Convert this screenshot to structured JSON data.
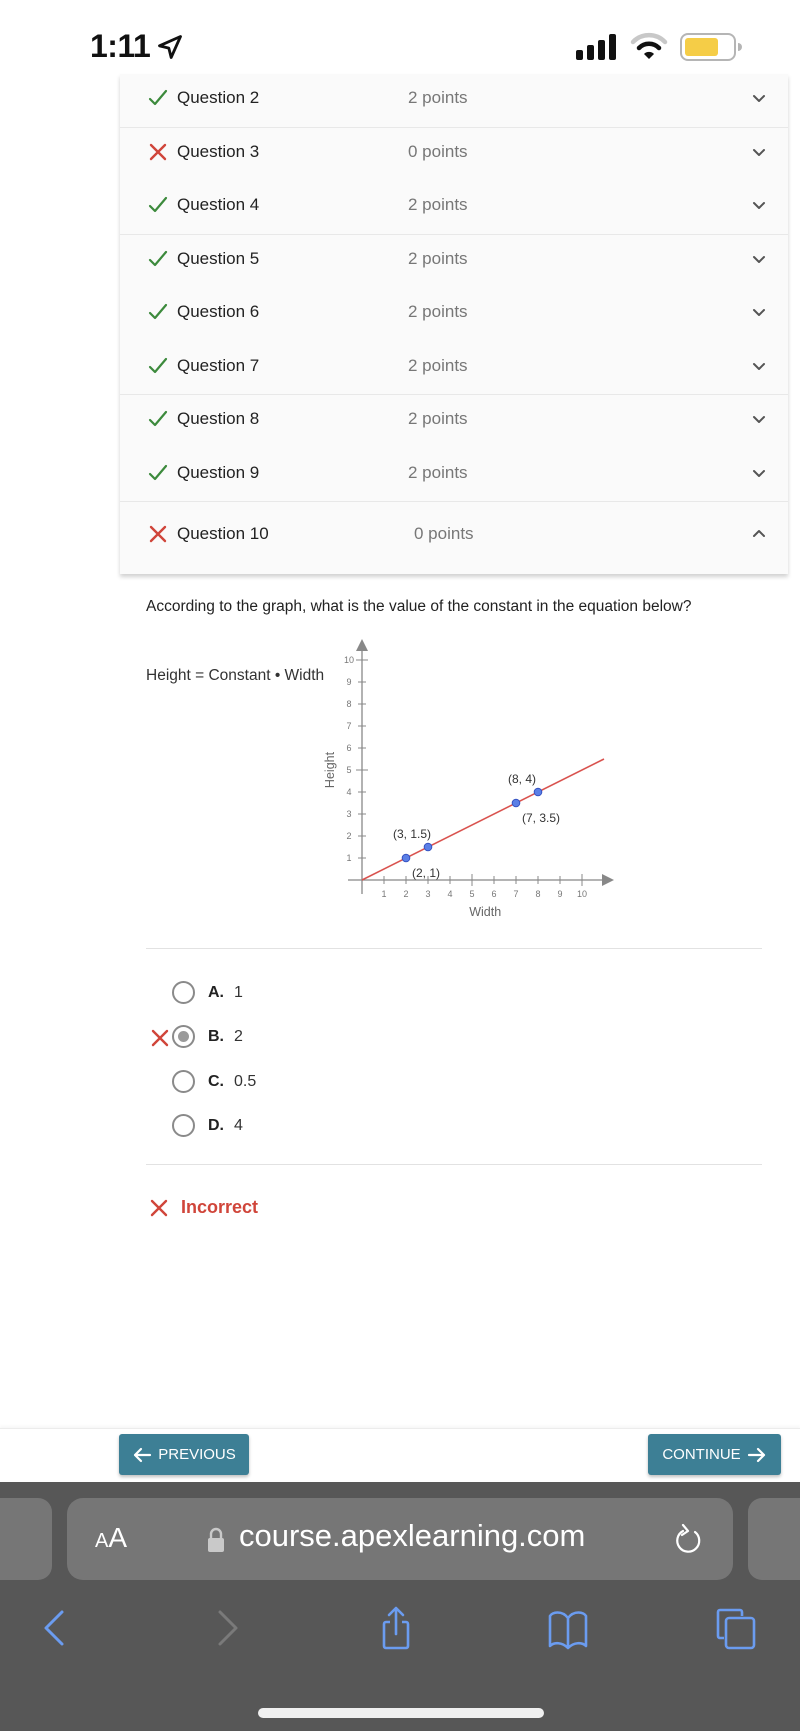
{
  "status_bar": {
    "time": "1:11",
    "location_icon": "location-arrow-icon",
    "signal_icon": "cellular-signal-icon",
    "wifi_icon": "wifi-icon",
    "battery_icon": "battery-icon",
    "battery_color": "#f5cd47"
  },
  "questions": [
    {
      "label": "Question 2",
      "points": "2 points",
      "status": "correct"
    },
    {
      "label": "Question 3",
      "points": "0 points",
      "status": "incorrect"
    },
    {
      "label": "Question 4",
      "points": "2 points",
      "status": "correct"
    },
    {
      "label": "Question 5",
      "points": "2 points",
      "status": "correct"
    },
    {
      "label": "Question 6",
      "points": "2 points",
      "status": "correct"
    },
    {
      "label": "Question 7",
      "points": "2 points",
      "status": "correct"
    },
    {
      "label": "Question 8",
      "points": "2 points",
      "status": "correct"
    },
    {
      "label": "Question 9",
      "points": "2 points",
      "status": "correct"
    },
    {
      "label": "Question 10",
      "points": "0 points",
      "status": "incorrect",
      "expanded": true
    }
  ],
  "question": {
    "prompt": "According to the graph, what is the value of the constant in the equation below?",
    "equation": "Height = Constant • Width"
  },
  "chart_data": {
    "type": "line",
    "xlabel": "Width",
    "ylabel": "Height",
    "xlim": [
      0,
      11
    ],
    "ylim": [
      0,
      10.5
    ],
    "x_ticks": [
      1,
      2,
      3,
      4,
      5,
      6,
      7,
      8,
      9,
      10
    ],
    "y_ticks": [
      1,
      2,
      3,
      4,
      5,
      6,
      7,
      8,
      9,
      10
    ],
    "line": {
      "slope": 0.5,
      "intercept": 0,
      "x_range": [
        0,
        11
      ],
      "color": "#d9534f"
    },
    "points": [
      {
        "x": 2,
        "y": 1,
        "label": "(2, 1)",
        "label_pos": "below-right"
      },
      {
        "x": 3,
        "y": 1.5,
        "label": "(3, 1.5)",
        "label_pos": "above-left"
      },
      {
        "x": 7,
        "y": 3.5,
        "label": "(7, 3.5)",
        "label_pos": "below-right"
      },
      {
        "x": 8,
        "y": 4,
        "label": "(8, 4)",
        "label_pos": "above-left"
      }
    ],
    "point_color": "#5b7fe6"
  },
  "choices": [
    {
      "letter": "A.",
      "value": "1",
      "selected": false
    },
    {
      "letter": "B.",
      "value": "2",
      "selected": true,
      "marked_wrong": true
    },
    {
      "letter": "C.",
      "value": "0.5",
      "selected": false
    },
    {
      "letter": "D.",
      "value": "4",
      "selected": false
    }
  ],
  "result": {
    "text": "Incorrect",
    "color": "#d0453a"
  },
  "nav": {
    "previous_label": "PREVIOUS",
    "continue_label": "CONTINUE",
    "button_color": "#3d7f95"
  },
  "browser": {
    "text_size_label_small": "A",
    "text_size_label_large": "A",
    "url": "course.apexlearning.com",
    "toolbar": [
      "back-icon",
      "forward-icon",
      "share-icon",
      "bookmarks-icon",
      "tabs-icon"
    ]
  },
  "colors": {
    "correct": "#3c8a3c",
    "incorrect": "#d0453a",
    "ios_blue": "#6b9cf0"
  }
}
